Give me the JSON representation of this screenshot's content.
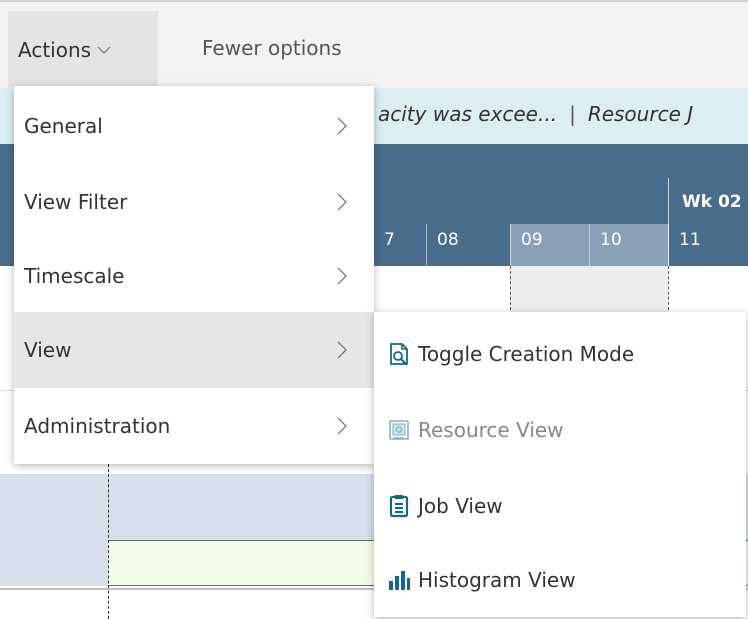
{
  "actionbar": {
    "actions_label": "Actions",
    "fewer_options_label": "Fewer options"
  },
  "notification": {
    "left_text": "acity was excee...",
    "separator": "|",
    "right_text": "Resource J"
  },
  "gantt": {
    "week_label": "Wk 02",
    "days": [
      "7",
      "08",
      "09",
      "10",
      "11"
    ]
  },
  "menu": {
    "items": [
      {
        "label": "General"
      },
      {
        "label": "View Filter"
      },
      {
        "label": "Timescale"
      },
      {
        "label": "View"
      },
      {
        "label": "Administration"
      }
    ]
  },
  "submenu": {
    "items": [
      {
        "label": "Toggle Creation Mode",
        "icon": "toggle-creation-icon"
      },
      {
        "label": "Resource View",
        "icon": "resource-view-icon",
        "disabled": true
      },
      {
        "label": "Job View",
        "icon": "clipboard-icon"
      },
      {
        "label": "Histogram View",
        "icon": "bar-chart-icon"
      }
    ]
  },
  "colors": {
    "accent": "#0b6a8c",
    "gantt_header": "#4a6c8c",
    "menu_highlight": "#e6e6e6"
  }
}
